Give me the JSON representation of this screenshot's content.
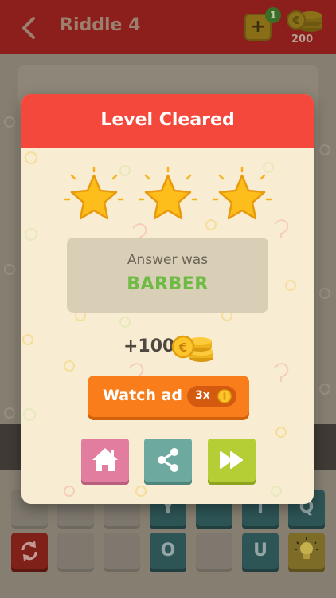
{
  "header": {
    "title": "Riddle 4",
    "hint_badge": "1",
    "coins": "200"
  },
  "game": {
    "visible_letters": [
      "Y",
      "T",
      "Q",
      "O",
      "U"
    ]
  },
  "dialog": {
    "title": "Level Cleared",
    "stars_earned": 3,
    "answer_label": "Answer was",
    "answer": "BARBER",
    "reward": "+100",
    "watch_ad_label": "Watch ad",
    "watch_ad_multiplier": "3x",
    "actions": [
      {
        "name": "home",
        "icon": "home-icon"
      },
      {
        "name": "share",
        "icon": "share-icon"
      },
      {
        "name": "next",
        "icon": "fast-forward-icon"
      }
    ]
  },
  "colors": {
    "dialog_header": "#f4483c",
    "dialog_body": "#f8edd3",
    "answer_text": "#6dbb45",
    "watch_ad_button": "#fa7d1c",
    "home_button": "#e27da0",
    "share_button": "#6ea9a0",
    "next_button": "#b6ce36",
    "star": "#fdbd1a"
  }
}
